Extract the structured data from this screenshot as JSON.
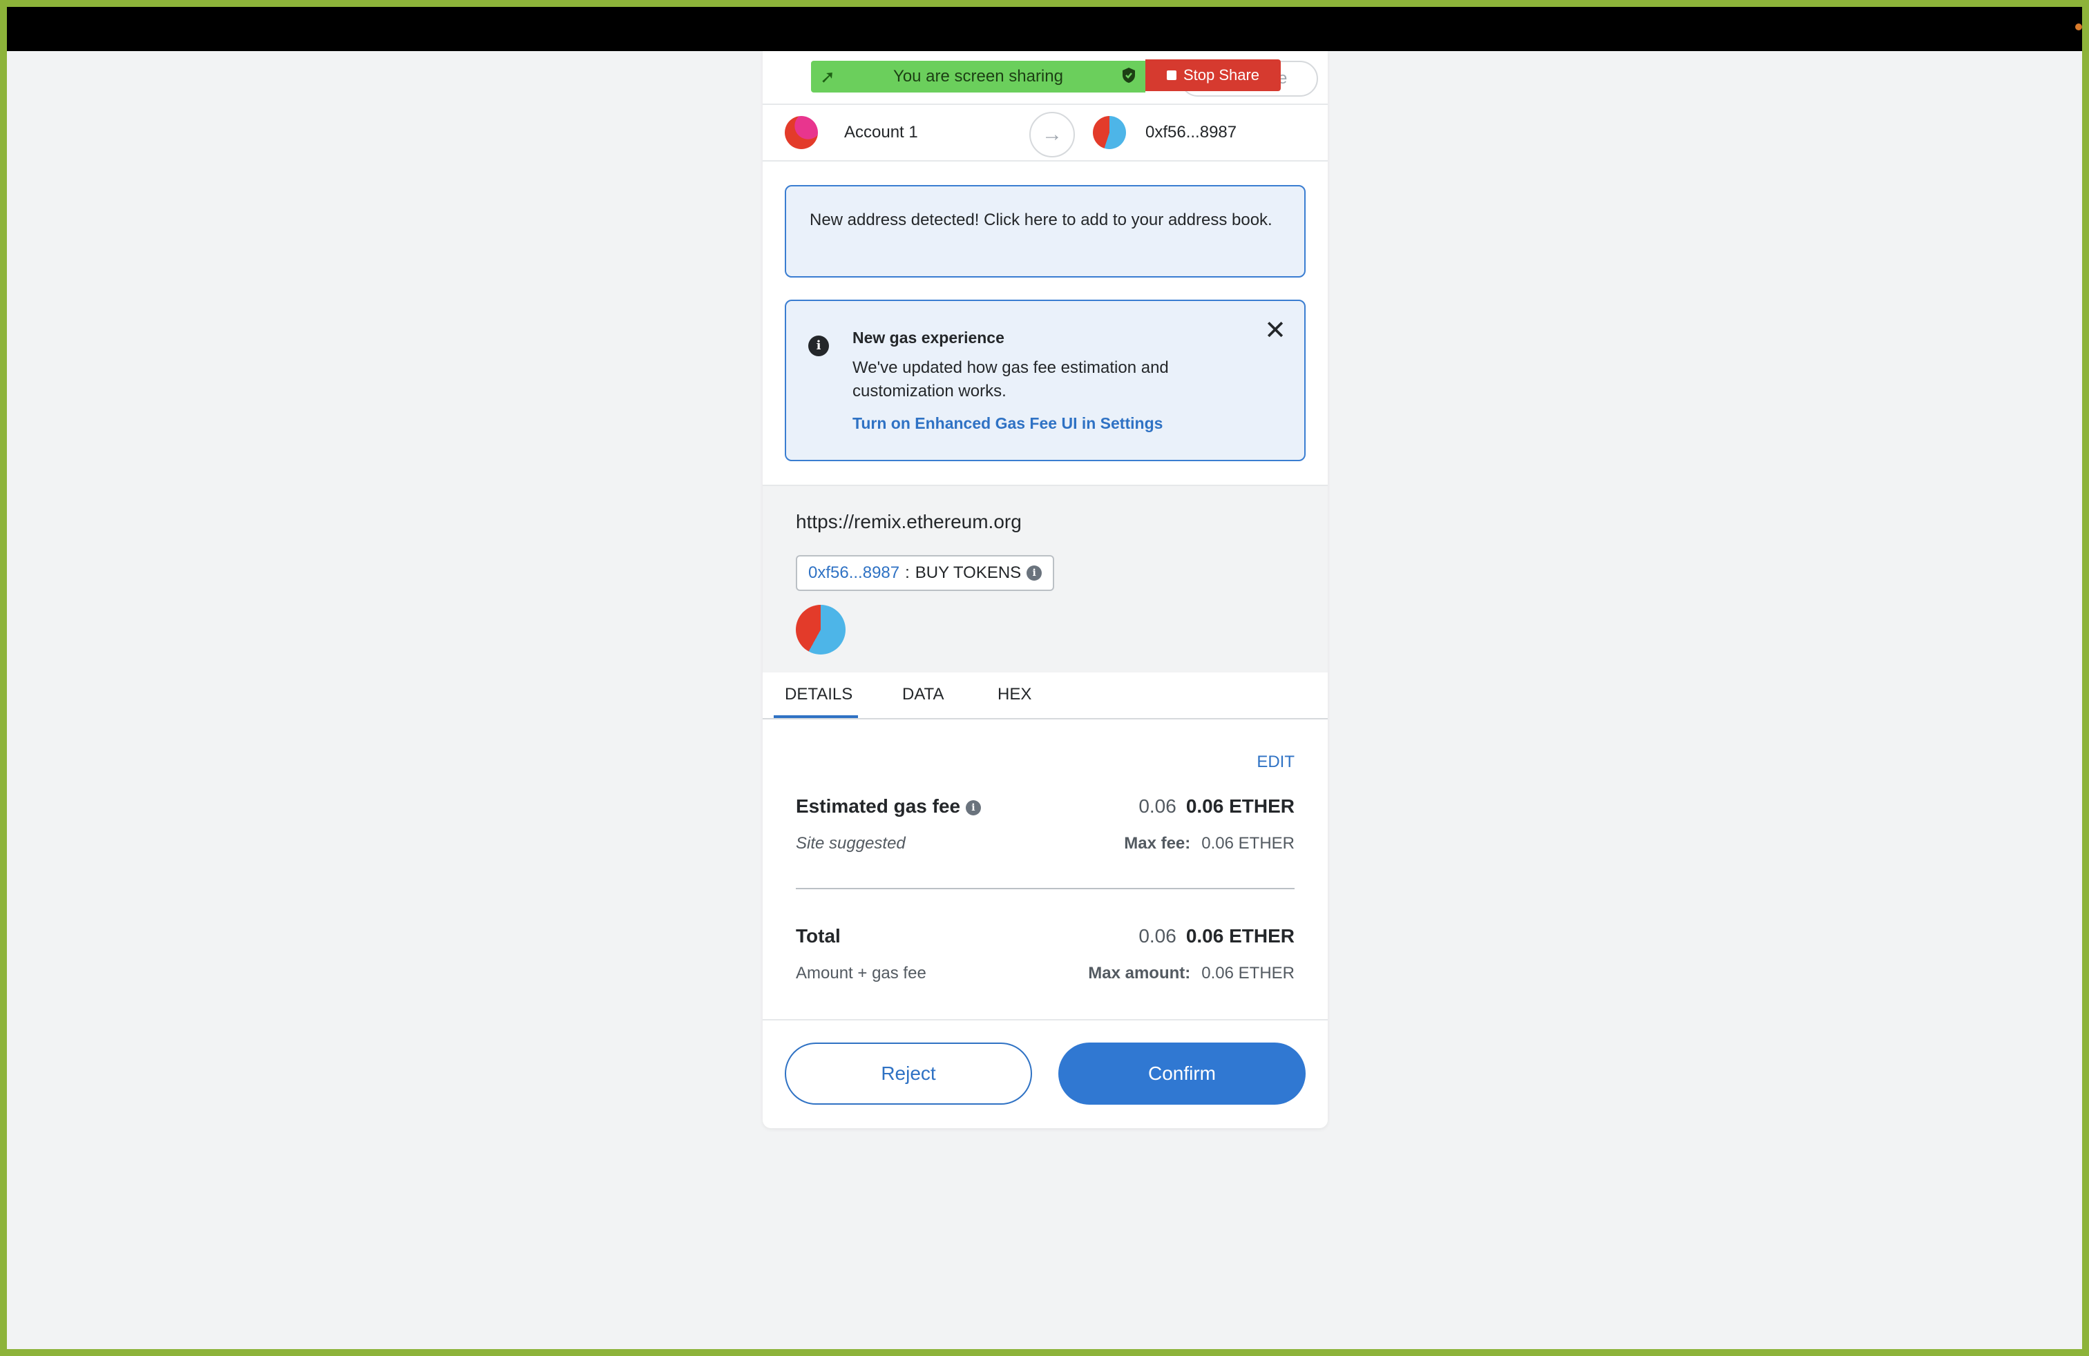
{
  "screen_share": {
    "banner_text": "You are screen sharing",
    "stop_label": "Stop Share"
  },
  "network_pill": {
    "label": "e"
  },
  "accounts": {
    "from_name": "Account 1",
    "to_address": "0xf56...8987"
  },
  "alerts": {
    "new_address": "New address detected! Click here to add to your address book.",
    "gas_title": "New gas experience",
    "gas_body": "We've updated how gas fee estimation and customization works.",
    "gas_link": "Turn on Enhanced Gas Fee UI in Settings"
  },
  "site": {
    "origin": "https://remix.ethereum.org",
    "method_address": "0xf56...8987",
    "method_separator": ":",
    "method_name": "BUY TOKENS"
  },
  "tabs": [
    "DETAILS",
    "DATA",
    "HEX"
  ],
  "details": {
    "edit_label": "EDIT",
    "gas_fee_label": "Estimated gas fee",
    "gas_fee_sub": "Site suggested",
    "gas_fee_fiat": "0.06",
    "gas_fee_value": "0.06 ETHER",
    "max_fee_label": "Max fee:",
    "max_fee_value": "0.06 ETHER",
    "total_label": "Total",
    "total_sub": "Amount + gas fee",
    "total_fiat": "0.06",
    "total_value": "0.06 ETHER",
    "max_amount_label": "Max amount:",
    "max_amount_value": "0.06 ETHER"
  },
  "buttons": {
    "reject": "Reject",
    "confirm": "Confirm"
  },
  "colors": {
    "accent": "#3078d2",
    "share_green": "#6bcf5c",
    "stop_red": "#d63a2f"
  }
}
